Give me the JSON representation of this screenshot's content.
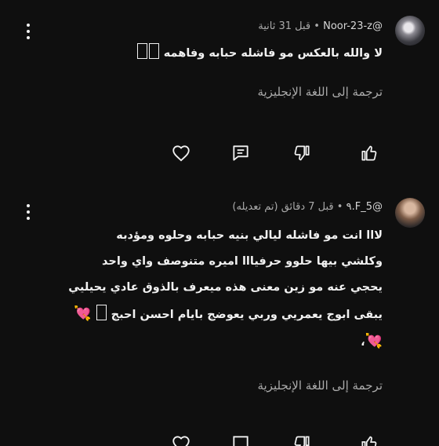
{
  "comments": [
    {
      "handle": "@Noor-23-z",
      "time": "قبل 31 ثانية",
      "text_lines": [
        "لا والله بالعكس مو فاشله حبابه وفاهمه"
      ],
      "translate_label": "ترجمة إلى اللغة الإنجليزية"
    },
    {
      "handle": "@5_F.٩",
      "time": "قبل 7 دقائق (تم تعديله)",
      "text_lines": [
        "لااا انت مو فاشله ليالي بنيه حبابه وحلوه ومؤدبه",
        "وكلشي بيها حلوو حرفيااا اميره متنوصف واي واحد",
        "يحجي عنه مو زين معنى هذه ميعرف بالذوق عادي يحيليي",
        "يبقى ابوج يعمريي وربي يعوضج بايام احسن احبج"
      ],
      "translate_label": "ترجمة إلى اللغة الإنجليزية"
    }
  ],
  "separator": "•",
  "icons": {
    "menu": "more-vert-icon",
    "heart": "heart-icon",
    "reply": "reply-icon",
    "dislike": "thumbs-down-icon",
    "like": "thumbs-up-icon",
    "emoji": "heart-emoji-icon"
  },
  "colors": {
    "background": "#0f0f0f",
    "text": "#f1f1f1",
    "muted": "#aaaaaa",
    "emoji": "#ff5fa2"
  }
}
